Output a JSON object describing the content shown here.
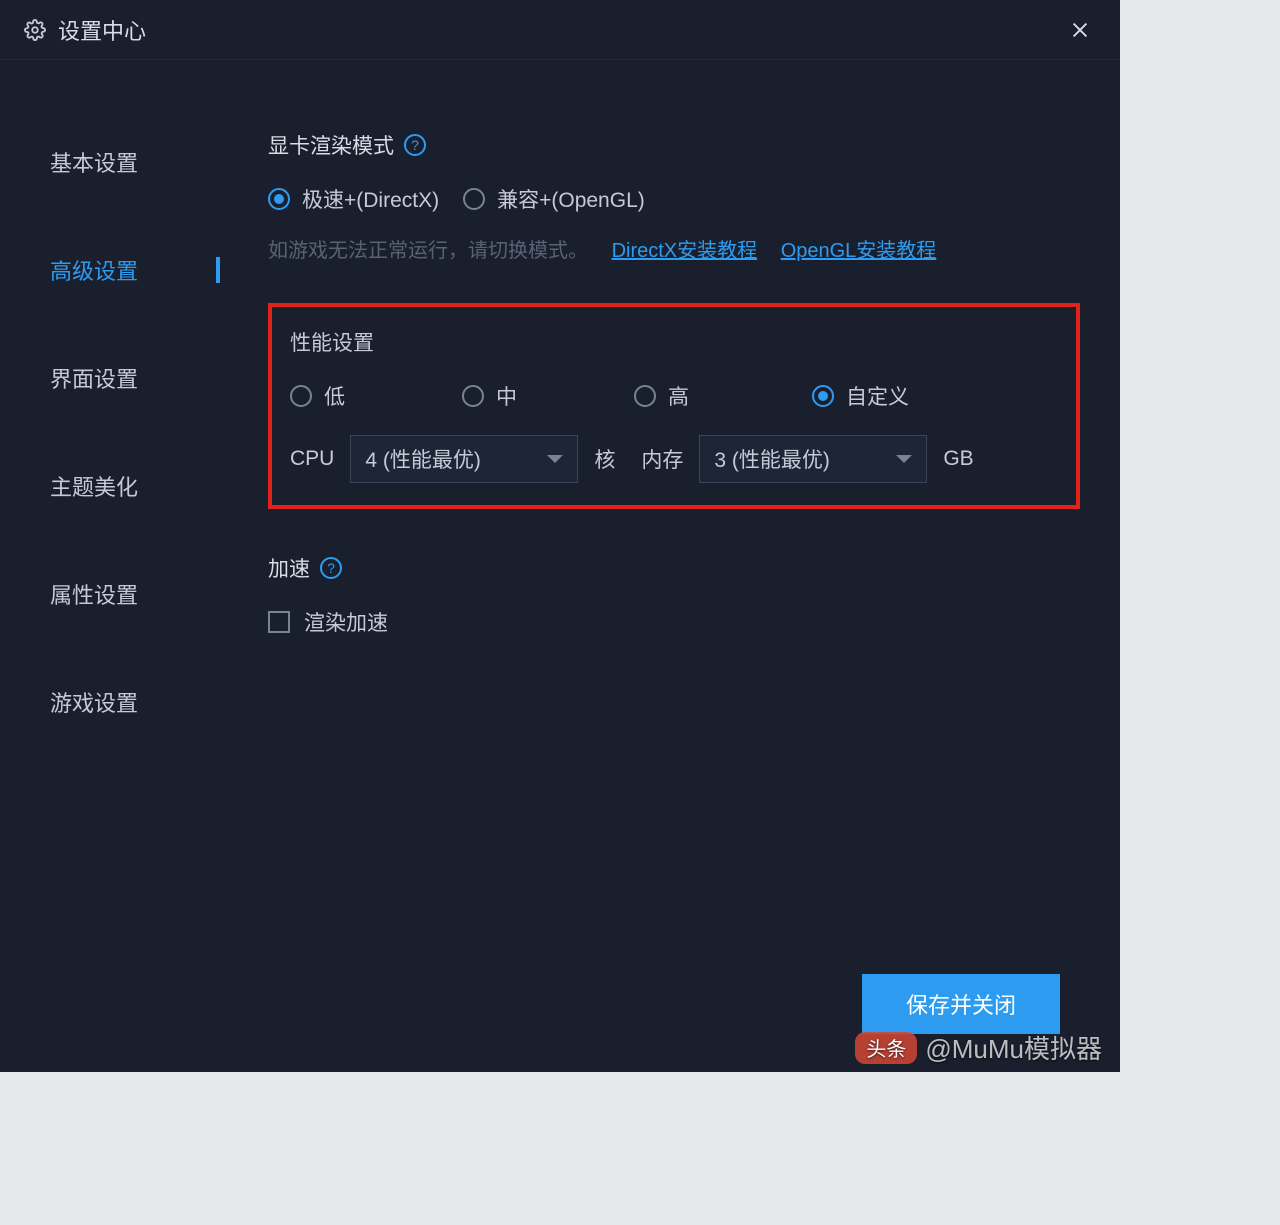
{
  "header": {
    "title": "设置中心"
  },
  "sidebar": {
    "items": [
      {
        "label": "基本设置",
        "active": false
      },
      {
        "label": "高级设置",
        "active": true
      },
      {
        "label": "界面设置",
        "active": false
      },
      {
        "label": "主题美化",
        "active": false
      },
      {
        "label": "属性设置",
        "active": false
      },
      {
        "label": "游戏设置",
        "active": false
      }
    ]
  },
  "render_mode": {
    "title": "显卡渲染模式",
    "options": [
      {
        "label": "极速+(DirectX)",
        "checked": true
      },
      {
        "label": "兼容+(OpenGL)",
        "checked": false
      }
    ],
    "hint_text": "如游戏无法正常运行，请切换模式。",
    "links": [
      {
        "label": "DirectX安装教程"
      },
      {
        "label": "OpenGL安装教程"
      }
    ]
  },
  "performance": {
    "title": "性能设置",
    "options": [
      {
        "label": "低",
        "checked": false
      },
      {
        "label": "中",
        "checked": false
      },
      {
        "label": "高",
        "checked": false
      },
      {
        "label": "自定义",
        "checked": true
      }
    ],
    "cpu_label": "CPU",
    "cpu_value": "4 (性能最优)",
    "cpu_unit": "核",
    "mem_label": "内存",
    "mem_value": "3 (性能最优)",
    "mem_unit": "GB"
  },
  "accelerate": {
    "title": "加速",
    "checkbox_label": "渲染加速"
  },
  "footer": {
    "save_label": "保存并关闭"
  },
  "watermark": {
    "badge": "头条",
    "text": "@MuMu模拟器"
  }
}
